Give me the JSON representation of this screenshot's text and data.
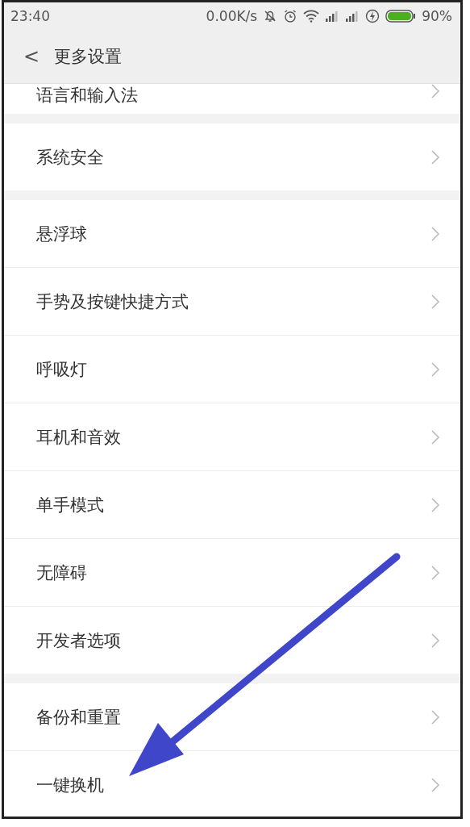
{
  "status_bar": {
    "time": "23:40",
    "net_speed": "0.00K/s",
    "battery": "90%"
  },
  "header": {
    "back": "<",
    "title": "更多设置"
  },
  "groups": [
    {
      "items": [
        {
          "label": "语言和输入法"
        }
      ]
    },
    {
      "items": [
        {
          "label": "系统安全"
        }
      ]
    },
    {
      "items": [
        {
          "label": "悬浮球"
        },
        {
          "label": "手势及按键快捷方式"
        },
        {
          "label": "呼吸灯"
        },
        {
          "label": "耳机和音效"
        },
        {
          "label": "单手模式"
        },
        {
          "label": "无障碍"
        },
        {
          "label": "开发者选项"
        }
      ]
    },
    {
      "items": [
        {
          "label": "备份和重置"
        },
        {
          "label": "一键换机"
        }
      ]
    }
  ]
}
